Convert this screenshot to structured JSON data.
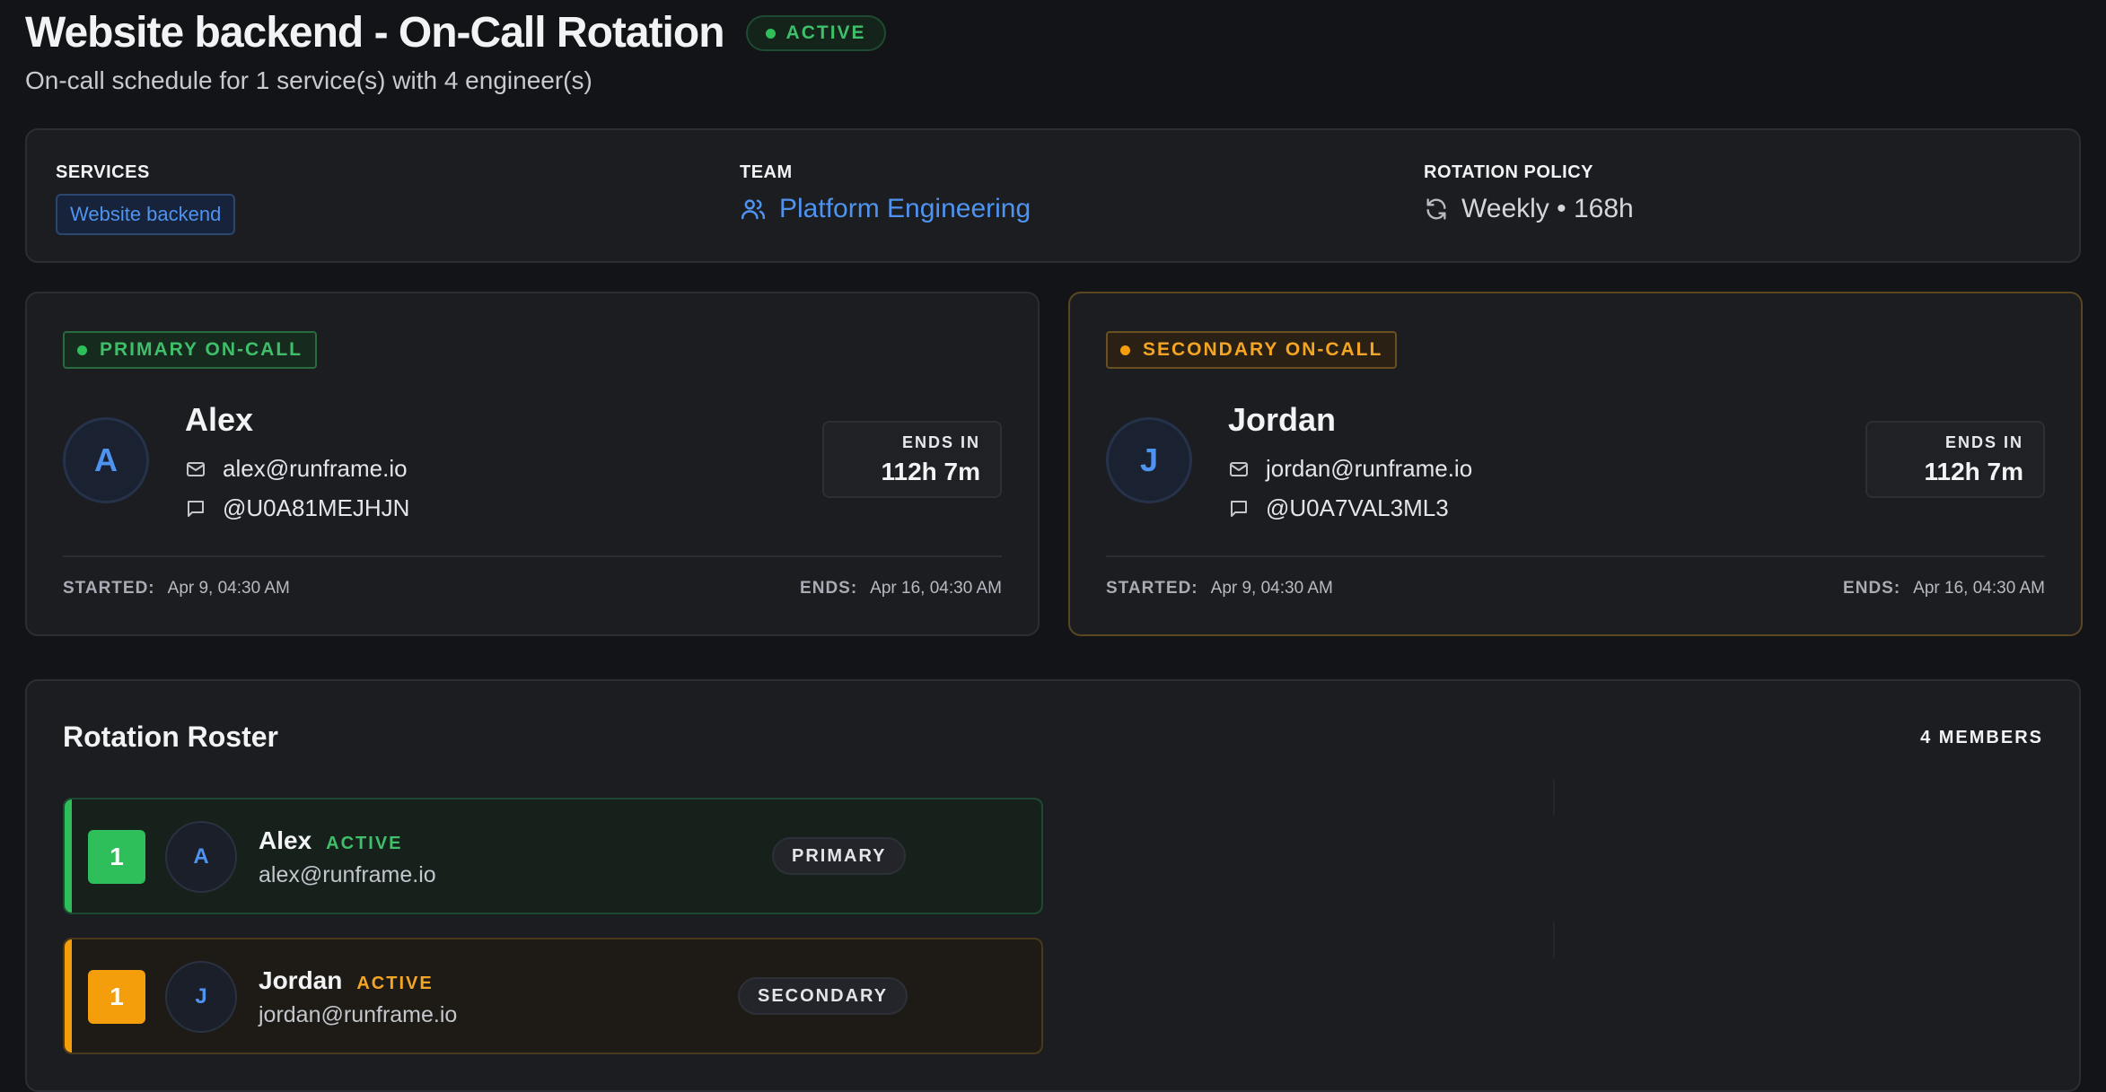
{
  "header": {
    "title": "Website backend - On-Call Rotation",
    "status": "ACTIVE",
    "subtitle": "On-call schedule for 1 service(s) with 4 engineer(s)"
  },
  "info": {
    "services_label": "SERVICES",
    "services": [
      "Website backend"
    ],
    "team_label": "TEAM",
    "team_name": "Platform Engineering",
    "policy_label": "ROTATION POLICY",
    "policy_value": "Weekly • 168h"
  },
  "primary": {
    "role_label": "PRIMARY ON-CALL",
    "initial": "A",
    "name": "Alex",
    "email": "alex@runframe.io",
    "slack": "@U0A81MEJHJN",
    "ends_in_label": "ENDS IN",
    "ends_in_value": "112h 7m",
    "started_label": "STARTED:",
    "started_value": "Apr 9, 04:30 AM",
    "ends_label": "ENDS:",
    "ends_value": "Apr 16, 04:30 AM"
  },
  "secondary": {
    "role_label": "SECONDARY ON-CALL",
    "initial": "J",
    "name": "Jordan",
    "email": "jordan@runframe.io",
    "slack": "@U0A7VAL3ML3",
    "ends_in_label": "ENDS IN",
    "ends_in_value": "112h 7m",
    "started_label": "STARTED:",
    "started_value": "Apr 9, 04:30 AM",
    "ends_label": "ENDS:",
    "ends_value": "Apr 16, 04:30 AM"
  },
  "roster": {
    "title": "Rotation Roster",
    "count_label": "4 MEMBERS",
    "members": [
      {
        "order": "1",
        "initial": "A",
        "name": "Alex",
        "status": "ACTIVE",
        "email": "alex@runframe.io",
        "role": "PRIMARY"
      },
      {
        "order": "1",
        "initial": "J",
        "name": "Jordan",
        "status": "ACTIVE",
        "email": "jordan@runframe.io",
        "role": "SECONDARY"
      }
    ]
  },
  "colors": {
    "accent_blue": "#4f93f0",
    "success_green": "#2fbf5a",
    "warning_orange": "#f59e0b",
    "background": "#131417"
  },
  "icons": [
    "users-icon",
    "refresh-icon",
    "mail-icon",
    "chat-icon"
  ]
}
